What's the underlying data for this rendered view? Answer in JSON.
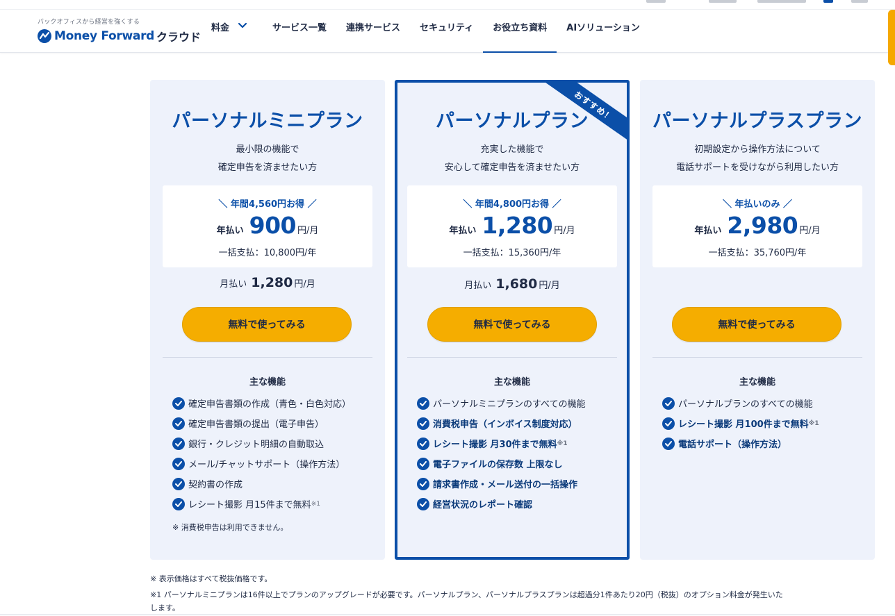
{
  "header": {
    "tagline": "バックオフィスから経営を強くする",
    "brand_name": "Money Forward",
    "brand_suffix": "クラウド",
    "nav": [
      {
        "label": "料金"
      },
      {
        "label": "サービス一覧"
      },
      {
        "label": "連携サービス"
      },
      {
        "label": "セキュリティ"
      },
      {
        "label": "お役立ち資料",
        "active": true
      },
      {
        "label": "AIソリューション"
      }
    ]
  },
  "plans": [
    {
      "title": "パーソナルミニプラン",
      "desc1": "最小限の機能で",
      "desc2": "確定申告を済ませたい方",
      "save": "＼ 年間4,560円お得 ／",
      "yearly_label": "年払い",
      "yearly_price": "900",
      "yearly_unit": "円/月",
      "lump": "一括支払：10,800円/年",
      "monthly_label": "月払い",
      "monthly_price": "1,280",
      "monthly_unit": "円/月",
      "cta": "無料で使ってみる",
      "features_heading": "主な機能",
      "features": [
        {
          "text": "確定申告書類の作成（青色・白色対応）",
          "bold": false
        },
        {
          "text": "確定申告書類の提出（電子申告）",
          "bold": false
        },
        {
          "text": "銀行・クレジット明細の自動取込",
          "bold": false
        },
        {
          "text": "メール/チャットサポート（操作方法）",
          "bold": false
        },
        {
          "text": "契約書の作成",
          "bold": false
        },
        {
          "text": "レシート撮影 月15件まで無料",
          "sup": "※1",
          "bold": false
        }
      ],
      "note": "※ 消費税申告は利用できません。"
    },
    {
      "title": "パーソナルプラン",
      "ribbon": "おすすめ！",
      "desc1": "充実した機能で",
      "desc2": "安心して確定申告を済ませたい方",
      "save": "＼ 年間4,800円お得 ／",
      "yearly_label": "年払い",
      "yearly_price": "1,280",
      "yearly_unit": "円/月",
      "lump": "一括支払：15,360円/年",
      "monthly_label": "月払い",
      "monthly_price": "1,680",
      "monthly_unit": "円/月",
      "cta": "無料で使ってみる",
      "features_heading": "主な機能",
      "features": [
        {
          "text": "パーソナルミニプランのすべての機能",
          "bold": false
        },
        {
          "text": "消費税申告（インボイス制度対応）",
          "bold": true
        },
        {
          "text": "レシート撮影 月30件まで無料",
          "sup": "※1",
          "bold": true
        },
        {
          "text": "電子ファイルの保存数 上限なし",
          "bold": true
        },
        {
          "text": "請求書作成・メール送付の一括操作",
          "bold": true
        },
        {
          "text": "経営状況のレポート確認",
          "bold": true
        }
      ]
    },
    {
      "title": "パーソナルプラスプラン",
      "desc1": "初期設定から操作方法について",
      "desc2": "電話サポートを受けながら利用したい方",
      "save": "＼ 年払いのみ ／",
      "yearly_label": "年払い",
      "yearly_price": "2,980",
      "yearly_unit": "円/月",
      "lump": "一括支払：35,760円/年",
      "cta": "無料で使ってみる",
      "features_heading": "主な機能",
      "features": [
        {
          "text": "パーソナルプランのすべての機能",
          "bold": false
        },
        {
          "text": "レシート撮影 月100件まで無料",
          "sup": "※1",
          "bold": true
        },
        {
          "text": "電話サポート（操作方法）",
          "bold": true
        }
      ]
    }
  ],
  "footnotes": {
    "line1": "※ 表示価格はすべて税抜価格です。",
    "line2": "※1 パーソナルミニプランは16件以上でプランのアップグレードが必要です。パーソナルプラン、パーソナルプラスプランは超過分1件あたり20円（税抜）のオプション料金が発生いた",
    "line3": "します。"
  },
  "colors": {
    "brand": "#0b4fa8",
    "cta": "#f5ad00",
    "card_bg": "#eef2fb"
  }
}
